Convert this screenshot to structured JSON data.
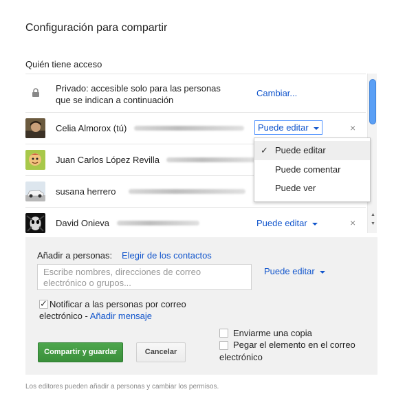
{
  "dialog": {
    "title": "Configuración para compartir",
    "access_heading": "Quién tiene acceso"
  },
  "privacy": {
    "icon": "lock-icon",
    "line1": "Privado: accesible solo para las personas",
    "line2": "que se indican a continuación",
    "change_link": "Cambiar..."
  },
  "people": [
    {
      "name": "Celia Almorox (tú)",
      "permission": "Puede editar",
      "avatar": "photo-avatar"
    },
    {
      "name": "Juan Carlos López Revilla",
      "avatar": "cartoon-avatar"
    },
    {
      "name": "susana herrero",
      "avatar": "car-avatar"
    },
    {
      "name": "David Onieva",
      "permission": "Puede editar",
      "avatar": "dark-face-avatar"
    }
  ],
  "remove_symbol": "×",
  "dropdown": {
    "options": [
      "Puede editar",
      "Puede comentar",
      "Puede ver"
    ],
    "selected": "Puede editar",
    "check": "✓"
  },
  "add": {
    "label": "Añadir a personas:",
    "contacts_link": "Elegir de los contactos",
    "placeholder_line1": "Escribe nombres, direcciones de correo",
    "placeholder_line2": "electrónico o grupos...",
    "permission": "Puede editar"
  },
  "notify": {
    "checked": true,
    "line1": "Notificar a las personas por correo",
    "line2_text": "electrónico - ",
    "line2_link": "Añadir mensaje"
  },
  "options": {
    "send_copy": "Enviarme una copia",
    "paste_line1": "Pegar el elemento en el correo",
    "paste_line2": "electrónico"
  },
  "buttons": {
    "share": "Compartir y guardar",
    "cancel": "Cancelar"
  },
  "footer": "Los editores pueden añadir a personas y cambiar los permisos.",
  "colors": {
    "link": "#1155cc",
    "share_button": "#3d9b3d",
    "scroll_thumb": "#5a9ff5"
  }
}
